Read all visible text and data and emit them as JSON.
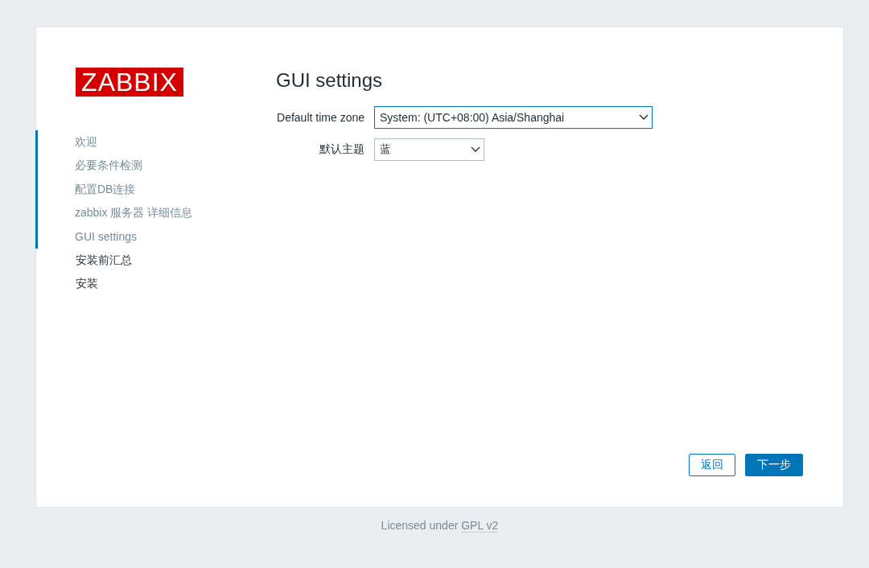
{
  "logo": "ZABBIX",
  "steps": [
    {
      "label": "欢迎",
      "done": true
    },
    {
      "label": "必要条件检测",
      "done": true
    },
    {
      "label": "配置DB连接",
      "done": true
    },
    {
      "label": "zabbix 服务器 详细信息",
      "done": true
    },
    {
      "label": "GUI settings",
      "done": true
    },
    {
      "label": "安装前汇总",
      "done": false
    },
    {
      "label": "安装",
      "done": false
    }
  ],
  "title": "GUI settings",
  "fields": [
    {
      "label": "Default time zone",
      "value": "System: (UTC+08:00) Asia/Shanghai",
      "focused": true
    },
    {
      "label": "默认主题",
      "value": "蓝",
      "focused": false
    }
  ],
  "buttons": [
    {
      "label": "返回",
      "kind": "secondary"
    },
    {
      "label": "下一步",
      "kind": "primary"
    }
  ],
  "footer": {
    "text": "Licensed under",
    "link": "GPL v2"
  }
}
